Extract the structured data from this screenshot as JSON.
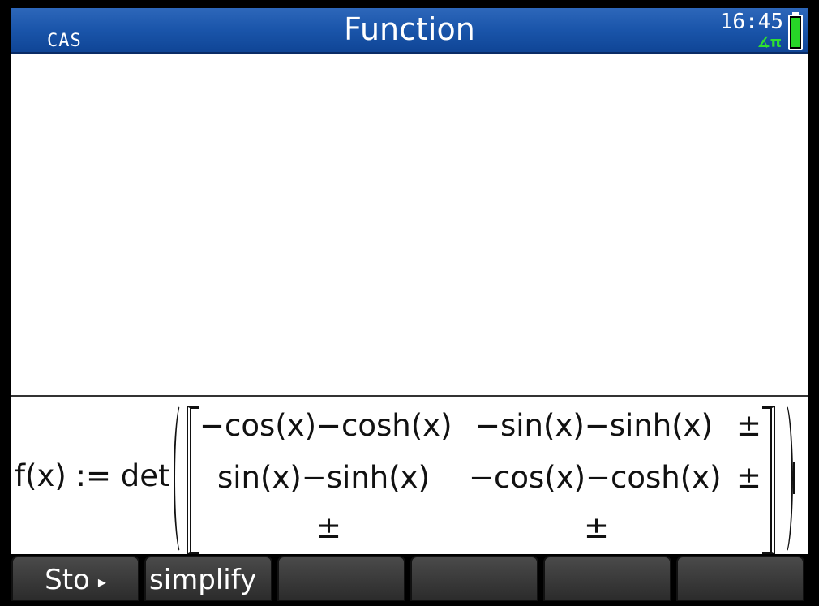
{
  "header": {
    "mode": "CAS",
    "title": "Function",
    "time": "16:45",
    "angle_mode": "∡π"
  },
  "entry": {
    "prefix": "f(x) := det",
    "matrix": [
      [
        "−cos(x)−cosh(x)",
        "−sin(x)−sinh(x)",
        "±"
      ],
      [
        "sin(x)−sinh(x)",
        "−cos(x)−cosh(x)",
        "±"
      ],
      [
        "±",
        "±",
        ""
      ]
    ]
  },
  "softmenu": {
    "items": [
      {
        "label": "Sto",
        "arrow": "▸"
      },
      {
        "label": "simplify"
      },
      {
        "label": ""
      },
      {
        "label": ""
      },
      {
        "label": ""
      },
      {
        "label": ""
      }
    ]
  },
  "colors": {
    "titlebar": "#1a55aa",
    "battery": "#27d627",
    "angle": "#2fe02f"
  }
}
